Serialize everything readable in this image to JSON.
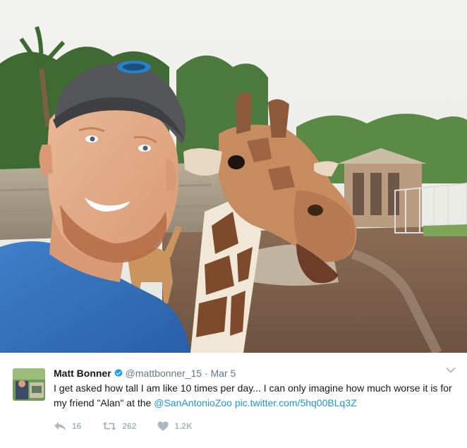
{
  "tweet": {
    "display_name": "Matt Bonner",
    "handle": "@mattbonner_15",
    "separator": "·",
    "date": "Mar 5",
    "text_main": "I get asked how tall I am like 10 times per day... I can only imagine how much worse it is for my friend \"Alan\" at the ",
    "mention": "@SanAntonioZoo",
    "space": " ",
    "media_link": "pic.twitter.com/5hq00BLq3Z"
  },
  "actions": {
    "reply_count": "16",
    "retweet_count": "262",
    "like_count": "1.2K"
  },
  "colors": {
    "link": "#1b95e0",
    "muted": "#657786",
    "action": "#aab8c2",
    "verified": "#1da1f2"
  },
  "icons": [
    "verified-badge-icon",
    "caret-down-icon",
    "reply-icon",
    "retweet-icon",
    "heart-icon"
  ]
}
